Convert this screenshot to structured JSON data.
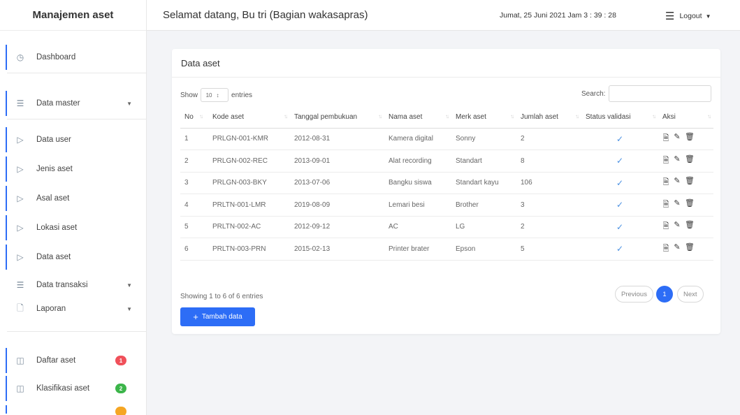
{
  "sidebar": {
    "brand": "Manajemen aset",
    "items": [
      {
        "label": "Dashboard",
        "icon": "clock-icon"
      },
      {
        "label": "Data master",
        "icon": "list-icon"
      },
      {
        "label": "Data user",
        "icon": "triangle-right-icon"
      },
      {
        "label": "Jenis aset",
        "icon": "triangle-right-icon"
      },
      {
        "label": "Asal aset",
        "icon": "triangle-right-icon"
      },
      {
        "label": "Lokasi aset",
        "icon": "triangle-right-icon"
      },
      {
        "label": "Data aset",
        "icon": "triangle-right-icon"
      },
      {
        "label": "Data transaksi",
        "icon": "list-icon"
      },
      {
        "label": "Laporan",
        "icon": "file-icon"
      },
      {
        "label": "Daftar aset",
        "icon": "book-icon",
        "badge": "1",
        "badge_color": "#f0505a"
      },
      {
        "label": "Klasifikasi aset",
        "icon": "grid-icon",
        "badge": "2",
        "badge_color": "#3cb54a"
      }
    ]
  },
  "topbar": {
    "welcome": "Selamat datang, Bu tri (Bagian wakasapras)",
    "datetime": "Jumat, 25 Juni 2021  Jam 3 : 39 : 28",
    "logout": "Logout"
  },
  "card": {
    "title": "Data aset",
    "show_label": "Show",
    "entries_value": "10",
    "entries_label": "entries",
    "search_label": "Search:",
    "search_value": "",
    "columns": [
      "No",
      "Kode aset",
      "Tanggal pembukuan",
      "Nama aset",
      "Merk aset",
      "Jumlah aset",
      "Status validasi",
      "Aksi"
    ],
    "rows": [
      {
        "no": "1",
        "kode": "PRLGN-001-KMR",
        "tanggal": "2012-08-31",
        "nama": "Kamera digital",
        "merk": "Sonny",
        "jumlah": "2"
      },
      {
        "no": "2",
        "kode": "PRLGN-002-REC",
        "tanggal": "2013-09-01",
        "nama": "Alat recording",
        "merk": "Standart",
        "jumlah": "8"
      },
      {
        "no": "3",
        "kode": "PRLGN-003-BKY",
        "tanggal": "2013-07-06",
        "nama": "Bangku siswa",
        "merk": "Standart kayu",
        "jumlah": "106"
      },
      {
        "no": "4",
        "kode": "PRLTN-001-LMR",
        "tanggal": "2019-08-09",
        "nama": "Lemari besi",
        "merk": "Brother",
        "jumlah": "3"
      },
      {
        "no": "5",
        "kode": "PRLTN-002-AC",
        "tanggal": "2012-09-12",
        "nama": "AC",
        "merk": "LG",
        "jumlah": "2"
      },
      {
        "no": "6",
        "kode": "PRLTN-003-PRN",
        "tanggal": "2015-02-13",
        "nama": "Printer brater",
        "merk": "Epson",
        "jumlah": "5"
      }
    ],
    "info": "Showing 1 to 6 of 6 entries",
    "pagination": {
      "previous": "Previous",
      "current": "1",
      "next": "Next"
    },
    "add_button": "Tambah data"
  },
  "colors": {
    "accent": "#2d6df6",
    "check": "#4a90e2"
  }
}
